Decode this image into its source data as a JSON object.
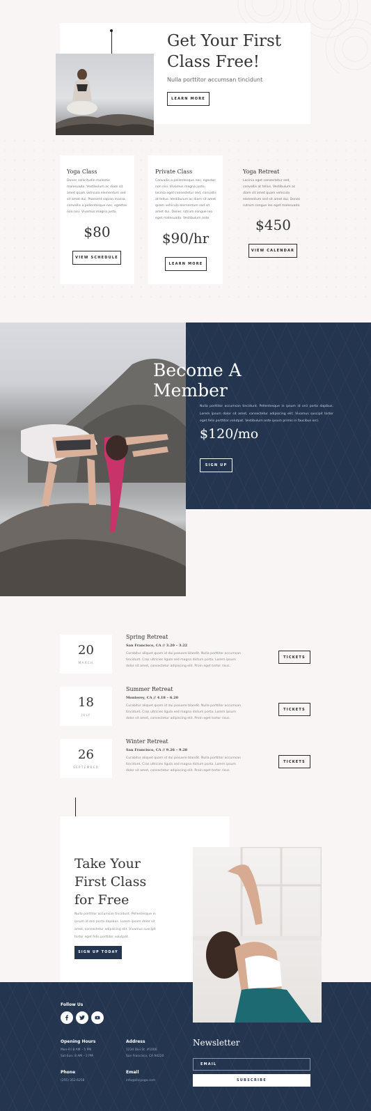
{
  "hero": {
    "title_line1": "Get Your First",
    "title_line2": "Class Free!",
    "subtitle": "Nulla porttitor accumsan tincidunt",
    "button": "LEARN MORE"
  },
  "pricing": [
    {
      "title": "Yoga Class",
      "desc": "Donec sollicitudin molestie malesuada. Vestibulum ac diam sit amet quam vehicula elementum sed sit amet dui. Praesent sapien massa, convallis a pellentesque nec, egestas non nisi. Vivamus magna justo.",
      "price": "$80",
      "button": "VIEW SCHEDULE"
    },
    {
      "title": "Private Class",
      "desc": "Convallis a pellentesque nec, egestas non nisi. Vivamus magna justo, lacinia eget consectetur sed, convallis at tellus. Vestibulum ac diam sit amet quam vehicula elementum sed sit amet dui. Donec rutrum congue leo eget malesuada. Vestibulum ante ipsum.",
      "price": "$90/hr",
      "button": "LEARN MORE"
    },
    {
      "title": "Yoga Retreat",
      "desc": "Lacinia eget consectetur sed, convallis at tellus. Vestibulum ac diam sit amet quam vehicula elementum sed sit amet dui. Donec rutrum congue leo eget malesuada. Vestibulum ante ipsum.",
      "price": "$450",
      "button": "VIEW CALENDAR"
    }
  ],
  "member": {
    "title_line1": "Become A",
    "title_line2": "Member",
    "desc": "Nulla porttitor accumsan tincidunt. Pellentesque in ipsum id orci porta dapibus. Lorem ipsum dolor sit amet, consectetur adipiscing elit. Vivamus suscipit tortor eget felis porttitor volutpat. Vestibulum ante ipsum primis in faucibus orci.",
    "price": "$120/mo",
    "button": "SIGN UP"
  },
  "events": [
    {
      "day": "20",
      "month": "MARCH",
      "title": "Spring Retreat",
      "location": "San Francisco, CA // 3.20 – 3.22",
      "desc": "Curabitur aliquet quam id dui posuere blandit. Nulla porttitor accumsan tincidunt. Cras ultricies ligula sed magna dictum porta. Lorem ipsum dolor sit amet, consectetur adipiscing elit. Proin eget tortor risus.",
      "button": "TICKETS"
    },
    {
      "day": "18",
      "month": "JULY",
      "title": "Summer Retreat",
      "location": "Monterey, CA // 4.18 – 6.20",
      "desc": "Curabitur aliquet quam id dui posuere blandit. Nulla porttitor accumsan tincidunt. Cras ultricies ligula sed magna dictum porta. Lorem ipsum dolor sit amet, consectetur adipiscing elit. Proin eget tortor risus.",
      "button": "TICKETS"
    },
    {
      "day": "26",
      "month": "SEPTEMBER",
      "title": "Winter Retreat",
      "location": "San Francisco, CA // 9.26 – 9.28",
      "desc": "Curabitur aliquet quam id dui posuere blandit. Nulla porttitor accumsan tincidunt. Cras ultricies ligula sed magna dictum porta. Lorem ipsum dolor sit amet, consectetur adipiscing elit. Proin eget tortor risus.",
      "button": "TICKETS"
    }
  ],
  "cta": {
    "title_line1": "Take Your",
    "title_line2": "First Class",
    "title_line3": "for Free",
    "desc": "Nulla porttitor accumsan tincidunt. Pellentesque in ipsum id orci porta dapibus. Lorem ipsum dolor sit amet, consectetur adipiscing elit. Vivamus suscipit tortor eget felis porttitor volutpat.",
    "button": "SIGN UP TODAY"
  },
  "footer": {
    "follow_label": "Follow Us",
    "social_icons": [
      "facebook-icon",
      "twitter-icon",
      "youtube-icon"
    ],
    "hours_head": "Opening Hours",
    "hours_line1": "Mon-Fri 8 AM – 5 PM",
    "hours_line2": "Sat-Sun: 8 AM – 2 PM",
    "address_head": "Address",
    "address_line1": "1234 Divi St. #1000",
    "address_line2": "San Francisco, CA 94220",
    "phone_head": "Phone",
    "phone": "(255) 352-6258",
    "email_head": "Email",
    "email": "info@diviyoga.com",
    "newsletter_title": "Newsletter",
    "email_placeholder": "EMAIL",
    "subscribe": "SUBSCRIBE"
  },
  "colors": {
    "navy": "#243550",
    "background": "#f8f5f4",
    "pink_hair": "#c8336a"
  }
}
